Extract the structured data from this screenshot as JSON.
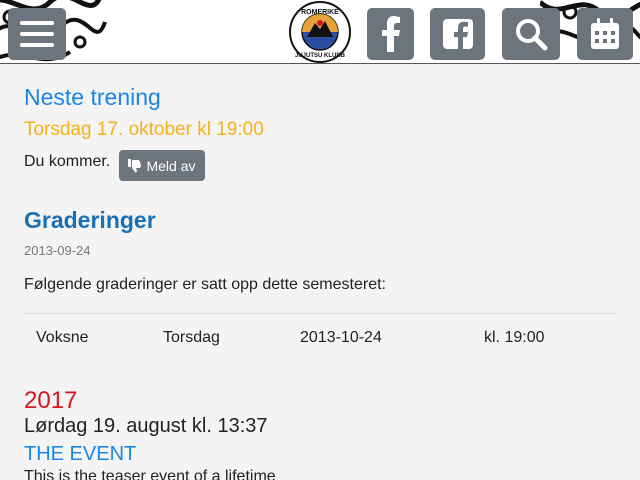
{
  "header": {
    "logo_text_top": "ROMERIKE",
    "logo_text_bottom": "JUJUTSU KLUBB",
    "buttons": [
      "menu-icon",
      "facebook-icon",
      "facebook-square-icon",
      "search-icon",
      "calendar-icon"
    ],
    "button_color": "#6c757d"
  },
  "next_training": {
    "heading": "Neste trening",
    "date": "Torsdag 17. oktober kl 19:00",
    "status": "Du kommer.",
    "cancel_label": "Meld av"
  },
  "gradings": {
    "heading": "Graderinger",
    "date": "2013-09-24",
    "description": "Følgende graderinger er satt opp dette semesteret:",
    "rows": [
      {
        "group": "Voksne",
        "day": "Torsdag",
        "date": "2013-10-24",
        "time": "kl. 19:00"
      }
    ]
  },
  "events": {
    "year": "2017",
    "date": "Lørdag 19. august kl. 13:37",
    "title": "THE EVENT",
    "teaser": "This is the teaser event of a lifetime"
  },
  "colors": {
    "heading_blue": "#1a87e8",
    "date_orange": "#f5b11a",
    "year_red": "#d9141a"
  }
}
